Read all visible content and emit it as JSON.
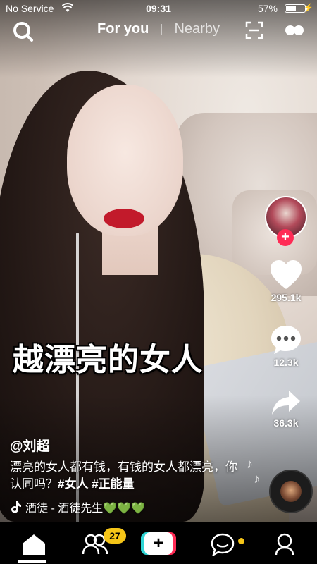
{
  "status_bar": {
    "carrier": "No Service",
    "time": "09:31",
    "battery_pct": "57%",
    "battery_level": 0.57
  },
  "top_nav": {
    "tab_for_you": "For you",
    "tab_nearby": "Nearby"
  },
  "video": {
    "overlay_caption": "越漂亮的女人"
  },
  "sidebar": {
    "likes": "295.1k",
    "comments": "12.3k",
    "shares": "36.3k"
  },
  "post": {
    "username": "@刘超",
    "description": "漂亮的女人都有钱，有钱的女人都漂亮，你认同吗？",
    "hashtags": [
      "#女人",
      "#正能量"
    ],
    "music": "酒徒 - 酒徒先生",
    "music_emoji": "💚💚💚"
  },
  "bottom_nav": {
    "friends_badge": "27",
    "create_symbol": "+"
  },
  "colors": {
    "accent_pink": "#ff2b55",
    "accent_cyan": "#2fd6d6",
    "badge_yellow": "#f5c518"
  }
}
